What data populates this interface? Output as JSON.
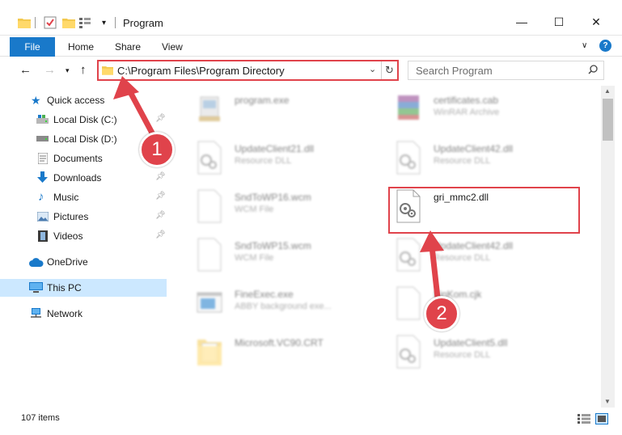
{
  "window": {
    "title": "Program",
    "controls": {
      "minimize": "—",
      "maximize": "☐",
      "close": "✕"
    }
  },
  "ribbon": {
    "tabs": [
      "File",
      "Home",
      "Share",
      "View"
    ],
    "help": "?"
  },
  "navigation": {
    "address": "C:\\Program Files\\Program Directory",
    "search_placeholder": "Search Program"
  },
  "sidebar": {
    "items": [
      {
        "label": "Quick access",
        "icon": "star-icon",
        "pinned": false
      },
      {
        "label": "Local Disk (C:)",
        "icon": "drive-icon",
        "pinned": true
      },
      {
        "label": "Local Disk (D:)",
        "icon": "drive-icon",
        "pinned": false
      },
      {
        "label": "Documents",
        "icon": "documents-icon",
        "pinned": true
      },
      {
        "label": "Downloads",
        "icon": "download-icon",
        "pinned": true
      },
      {
        "label": "Music",
        "icon": "music-icon",
        "pinned": true
      },
      {
        "label": "Pictures",
        "icon": "pictures-icon",
        "pinned": true
      },
      {
        "label": "Videos",
        "icon": "videos-icon",
        "pinned": true
      },
      {
        "label": "OneDrive",
        "icon": "cloud-icon",
        "pinned": false
      },
      {
        "label": "This PC",
        "icon": "computer-icon",
        "pinned": false,
        "selected": true
      },
      {
        "label": "Network",
        "icon": "network-icon",
        "pinned": false
      }
    ]
  },
  "files": [
    {
      "name": "program.exe",
      "type": "",
      "icon": "exe-icon",
      "highlighted": false
    },
    {
      "name": "certificates.cab",
      "type": "WinRAR Archive",
      "icon": "archive-icon",
      "highlighted": false
    },
    {
      "name": "UpdateClient21.dll",
      "type": "Resource DLL",
      "icon": "dll-icon",
      "highlighted": false
    },
    {
      "name": "UpdateClient42.dll",
      "type": "Resource DLL",
      "icon": "dll-icon",
      "highlighted": false
    },
    {
      "name": "SndToWP16.wcm",
      "type": "WCM File",
      "icon": "file-icon",
      "highlighted": false
    },
    {
      "name": "gri_mmc2.dll",
      "type": "",
      "icon": "dll-icon",
      "highlighted": true
    },
    {
      "name": "SndToWP15.wcm",
      "type": "WCM File",
      "icon": "file-icon",
      "highlighted": false
    },
    {
      "name": "UpdateClient42.dll",
      "type": "Resource DLL",
      "icon": "dll-icon",
      "highlighted": false
    },
    {
      "name": "FineExec.exe",
      "type": "ABBY background exe...",
      "icon": "window-icon",
      "highlighted": false
    },
    {
      "name": "FinKom.cjk",
      "type": "",
      "icon": "file-icon",
      "highlighted": false
    },
    {
      "name": "Microsoft.VC90.CRT",
      "type": "",
      "icon": "folder-icon",
      "highlighted": false
    },
    {
      "name": "UpdateClient5.dll",
      "type": "Resource DLL",
      "icon": "dll-icon",
      "highlighted": false
    }
  ],
  "status": {
    "item_count": "107 items"
  },
  "annotations": {
    "step1": "1",
    "step2": "2"
  },
  "colors": {
    "accent": "#1979ca",
    "highlight": "#e0434b",
    "selected": "#cce8ff"
  }
}
